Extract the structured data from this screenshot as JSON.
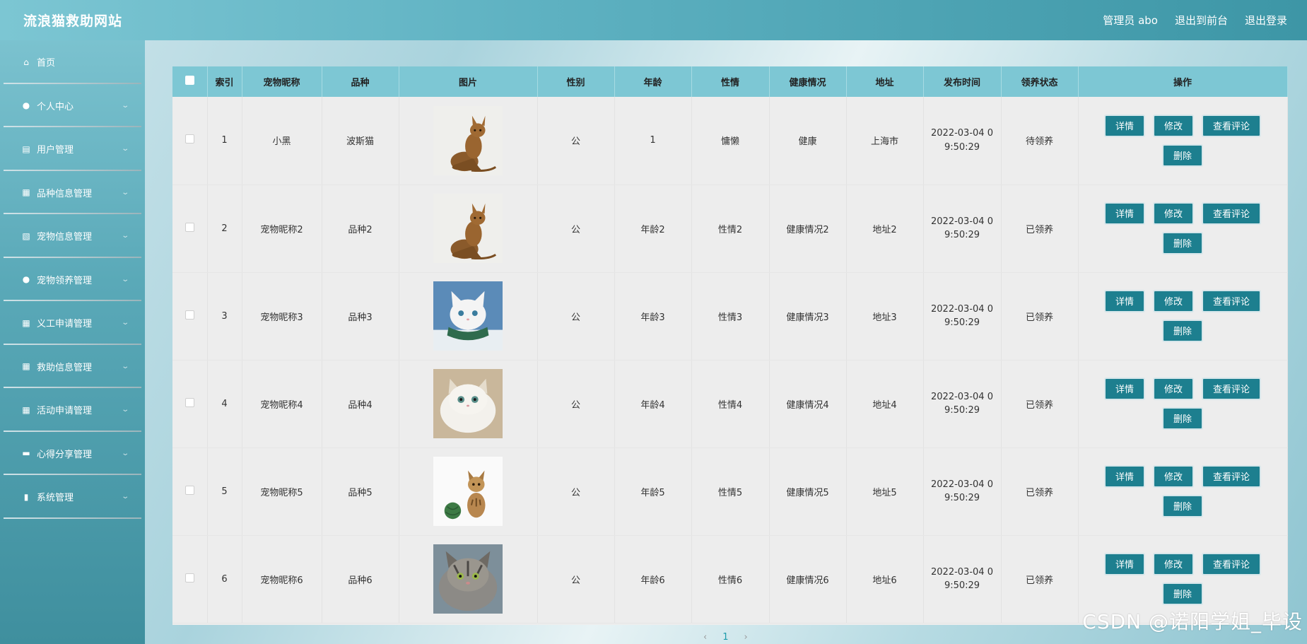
{
  "header": {
    "title": "流浪猫救助网站",
    "admin_label": "管理员 abo",
    "front_label": "退出到前台",
    "logout_label": "退出登录"
  },
  "sidebar": {
    "items": [
      {
        "label": "首页",
        "icon": "home-icon",
        "glyph": "⌂"
      },
      {
        "label": "个人中心",
        "icon": "user-icon",
        "glyph": "●"
      },
      {
        "label": "用户管理",
        "icon": "clipboard-icon",
        "glyph": "▤"
      },
      {
        "label": "品种信息管理",
        "icon": "grid-icon",
        "glyph": "▦"
      },
      {
        "label": "宠物信息管理",
        "icon": "chart-box-icon",
        "glyph": "▧"
      },
      {
        "label": "宠物领养管理",
        "icon": "user-icon",
        "glyph": "●"
      },
      {
        "label": "义工申请管理",
        "icon": "grid-icon",
        "glyph": "▦"
      },
      {
        "label": "救助信息管理",
        "icon": "grid-icon",
        "glyph": "▦"
      },
      {
        "label": "活动申请管理",
        "icon": "grid-icon",
        "glyph": "▦"
      },
      {
        "label": "心得分享管理",
        "icon": "briefcase-icon",
        "glyph": "▬"
      },
      {
        "label": "系统管理",
        "icon": "bar-chart-icon",
        "glyph": "▮"
      }
    ],
    "chevron": "⌄"
  },
  "table": {
    "headers": [
      "",
      "索引",
      "宠物昵称",
      "品种",
      "图片",
      "性别",
      "年龄",
      "性情",
      "健康情况",
      "地址",
      "发布时间",
      "领养状态",
      "操作"
    ],
    "rows": [
      {
        "index": "1",
        "name": "小黑",
        "breed": "波斯猫",
        "gender": "公",
        "age": "1",
        "temper": "慵懒",
        "health": "健康",
        "address": "上海市",
        "time1": "2022-03-04 0",
        "time2": "9:50:29",
        "status": "待领养",
        "img": "cat-sitting-brown"
      },
      {
        "index": "2",
        "name": "宠物昵称2",
        "breed": "品种2",
        "gender": "公",
        "age": "年龄2",
        "temper": "性情2",
        "health": "健康情况2",
        "address": "地址2",
        "time1": "2022-03-04 0",
        "time2": "9:50:29",
        "status": "已领养",
        "img": "cat-sitting-brown"
      },
      {
        "index": "3",
        "name": "宠物昵称3",
        "breed": "品种3",
        "gender": "公",
        "age": "年龄3",
        "temper": "性情3",
        "health": "健康情况3",
        "address": "地址3",
        "time1": "2022-03-04 0",
        "time2": "9:50:29",
        "status": "已领养",
        "img": "cat-white-scarf"
      },
      {
        "index": "4",
        "name": "宠物昵称4",
        "breed": "品种4",
        "gender": "公",
        "age": "年龄4",
        "temper": "性情4",
        "health": "健康情况4",
        "address": "地址4",
        "time1": "2022-03-04 0",
        "time2": "9:50:29",
        "status": "已领养",
        "img": "cat-white-fluffy"
      },
      {
        "index": "5",
        "name": "宠物昵称5",
        "breed": "品种5",
        "gender": "公",
        "age": "年龄5",
        "temper": "性情5",
        "health": "健康情况5",
        "address": "地址5",
        "time1": "2022-03-04 0",
        "time2": "9:50:29",
        "status": "已领养",
        "img": "kitten-yarn"
      },
      {
        "index": "6",
        "name": "宠物昵称6",
        "breed": "品种6",
        "gender": "公",
        "age": "年龄6",
        "temper": "性情6",
        "health": "健康情况6",
        "address": "地址6",
        "time1": "2022-03-04 0",
        "time2": "9:50:29",
        "status": "已领养",
        "img": "cat-tabby-gray"
      }
    ],
    "actions": {
      "detail": "详情",
      "edit": "修改",
      "comments": "查看评论",
      "delete": "删除"
    }
  },
  "pager": {
    "prev": "‹",
    "current": "1",
    "next": "›"
  },
  "colors": {
    "header_bg": "#5fb2c2",
    "table_header": "#7dc7d4",
    "button": "#1d7f8f"
  },
  "watermark": "CSDN @诺阳学姐_毕设"
}
